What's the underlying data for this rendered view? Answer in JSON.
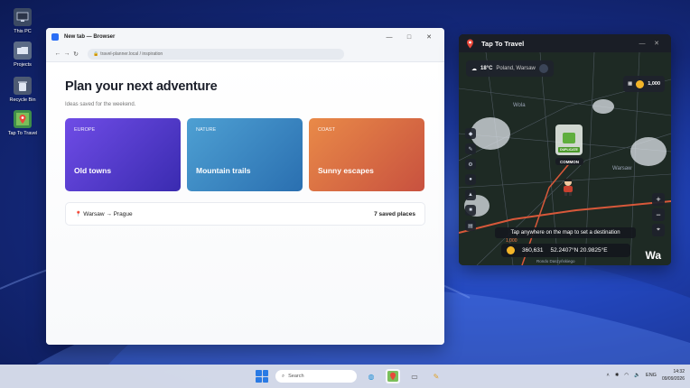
{
  "desktop": {
    "icons": [
      {
        "label": "This PC"
      },
      {
        "label": "Projects"
      },
      {
        "label": "Recycle Bin"
      },
      {
        "label": "Tap To Travel"
      }
    ]
  },
  "browser": {
    "window_title": "New tab — Browser",
    "address": "travel-planner.local / inspiration",
    "heading": "Plan your next adventure",
    "subheading": "Ideas saved for the weekend.",
    "cards": [
      {
        "tag": "EUROPE",
        "name": "Old towns"
      },
      {
        "tag": "NATURE",
        "name": "Mountain trails"
      },
      {
        "tag": "COAST",
        "name": "Sunny escapes"
      }
    ],
    "route": "Warsaw → Prague",
    "saved_places": "7 saved places"
  },
  "tap_to_travel": {
    "window_title": "Tap To Travel",
    "weather": {
      "temp": "18°C",
      "place": "Poland, Warsaw"
    },
    "coins_top": "1,000",
    "chest_label": "DUPLICATE",
    "rarity": "COMMON",
    "hint": "Tap anywhere on the map to set a destination",
    "distance": "1,000",
    "coins": "360,631",
    "coordinates": "52.2407°N 20.9825°E",
    "city_label": "Wa",
    "street": "Rondo Daszyńskiego",
    "map_labels": [
      "Wola",
      "Warsaw"
    ]
  },
  "taskbar": {
    "search_placeholder": "Search",
    "lang": "ENG",
    "time": "14:32",
    "date": "09/09/2026"
  }
}
